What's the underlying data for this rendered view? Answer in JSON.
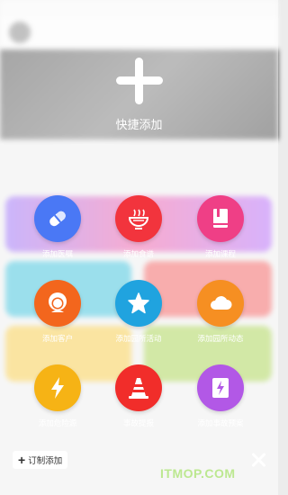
{
  "quick_add": {
    "label": "快捷添加"
  },
  "items": [
    {
      "label": "添加医嘱",
      "color": "#4a78f5",
      "icon": "pill-icon"
    },
    {
      "label": "添加食谱",
      "color": "#f2343d",
      "icon": "bowl-icon"
    },
    {
      "label": "添加课程",
      "color": "#ef3f86",
      "icon": "book-icon"
    },
    {
      "label": "添加客户",
      "color": "#f3661d",
      "icon": "customer-icon"
    },
    {
      "label": "添加园所活动",
      "color": "#20a3df",
      "icon": "star-icon"
    },
    {
      "label": "添加园所动态",
      "color": "#f68f22",
      "icon": "cloud-icon"
    },
    {
      "label": "添加危险源",
      "color": "#f6b315",
      "icon": "lightning-icon"
    },
    {
      "label": "事故提报",
      "color": "#f12d2a",
      "icon": "traffic-cone-icon"
    },
    {
      "label": "添加事故预案",
      "color": "#b258e6",
      "icon": "document-bolt-icon"
    }
  ],
  "custom_add": {
    "label": "订制添加"
  },
  "watermark": "ITMOP.COM"
}
